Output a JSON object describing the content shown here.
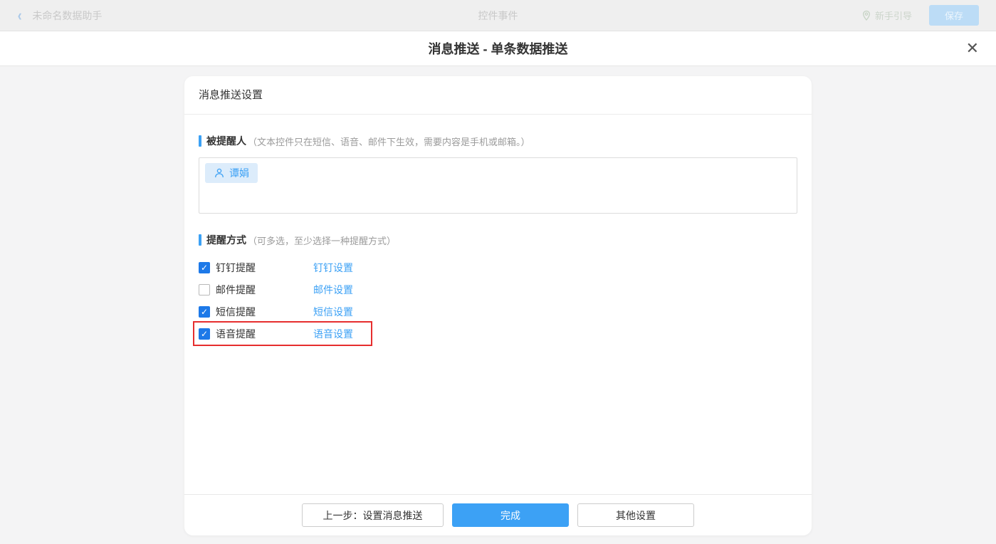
{
  "topbar": {
    "back_label": "未命名数据助手",
    "center_title": "控件事件",
    "guide_label": "新手引导",
    "save_label": "保存"
  },
  "modal": {
    "title": "消息推送 - 单条数据推送",
    "card": {
      "header": "消息推送设置",
      "recipient_section": {
        "label": "被提醒人",
        "note": "（文本控件只在短信、语音、邮件下生效，需要内容是手机或邮箱。）",
        "recipients": [
          {
            "name": "谭娟"
          }
        ]
      },
      "method_section": {
        "label": "提醒方式",
        "note": "（可多选，至少选择一种提醒方式）",
        "options": [
          {
            "label": "钉钉提醒",
            "link": "钉钉设置",
            "checked": true,
            "highlighted": false
          },
          {
            "label": "邮件提醒",
            "link": "邮件设置",
            "checked": false,
            "highlighted": false
          },
          {
            "label": "短信提醒",
            "link": "短信设置",
            "checked": true,
            "highlighted": false
          },
          {
            "label": "语音提醒",
            "link": "语音设置",
            "checked": true,
            "highlighted": true
          }
        ]
      },
      "footer": {
        "prev_label": "上一步：设置消息推送",
        "done_label": "完成",
        "other_label": "其他设置"
      }
    }
  },
  "colors": {
    "accent_blue": "#3ca1f5",
    "checkbox_blue": "#1d79e8",
    "highlight_red": "#e62e2e",
    "tag_bg": "#dcecfb",
    "page_bg": "#f4f4f5"
  }
}
